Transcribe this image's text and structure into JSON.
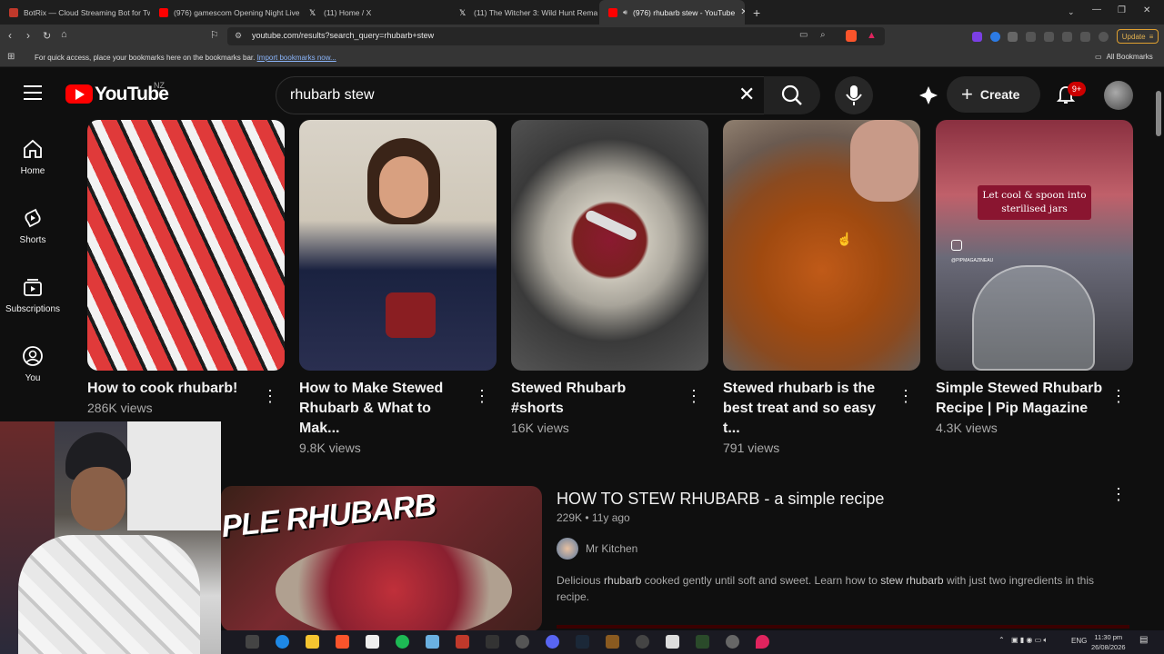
{
  "browser": {
    "tabs": [
      {
        "title": "BotRix — Cloud Streaming Bot for Tw",
        "color": "#c0392b"
      },
      {
        "title": "(976) gamescom Opening Night Live",
        "color": "#ff0000"
      },
      {
        "title": "(11) Home / X",
        "color": "#ffffff"
      },
      {
        "title": "(11) The Witcher 3: Wild Hunt Remas",
        "color": "#ffffff"
      },
      {
        "title": "(976) rhubarb stew - YouTube",
        "color": "#ff0000"
      }
    ],
    "url": "youtube.com/results?search_query=rhubarb+stew",
    "bookmarks_hint": "For quick access, place your bookmarks here on the bookmarks bar.",
    "import_link": "Import bookmarks now...",
    "all_bookmarks": "All Bookmarks",
    "update_label": "Update"
  },
  "youtube": {
    "logo_text": "YouTube",
    "country": "NZ",
    "search_value": "rhubarb stew",
    "create_label": "Create",
    "notif_count": "9+",
    "sidebar": [
      {
        "label": "Home",
        "icon": "home-icon"
      },
      {
        "label": "Shorts",
        "icon": "shorts-icon"
      },
      {
        "label": "Subscriptions",
        "icon": "subscriptions-icon"
      },
      {
        "label": "You",
        "icon": "you-icon"
      }
    ],
    "shorts": [
      {
        "line1": "How to cook rhubarb!",
        "line2": "",
        "views": "286K views"
      },
      {
        "line1": "How to Make Stewed",
        "line2": "Rhubarb & What to Mak...",
        "views": "9.8K views"
      },
      {
        "line1": "Stewed Rhubarb #shorts",
        "line2": "",
        "views": "16K views"
      },
      {
        "line1": "Stewed rhubarb is the",
        "line2": "best treat and so easy t...",
        "views": "791 views"
      },
      {
        "line1": "Simple Stewed Rhubarb",
        "line2": "Recipe | Pip Magazine",
        "views": "4.3K views"
      }
    ],
    "short5_overlay": {
      "line1": "Let cool & spoon into",
      "line2": "sterilised jars",
      "handle": "@PIPMAGAZINEAU"
    },
    "video": {
      "thumb_text": "PLE RHUBARB",
      "title": "HOW TO STEW RHUBARB - a simple recipe",
      "views": "229K",
      "age": "11y ago",
      "channel": "Mr Kitchen",
      "desc_1": "Delicious ",
      "desc_b1": "rhubarb",
      "desc_2": " cooked gently until soft and sweet. Learn how to ",
      "desc_b2": "stew rhubarb",
      "desc_3": " with just two ingredients in this recipe."
    }
  },
  "taskbar": {
    "lang": "ENG",
    "time": "11:30 pm",
    "date": "26/08/2026"
  }
}
